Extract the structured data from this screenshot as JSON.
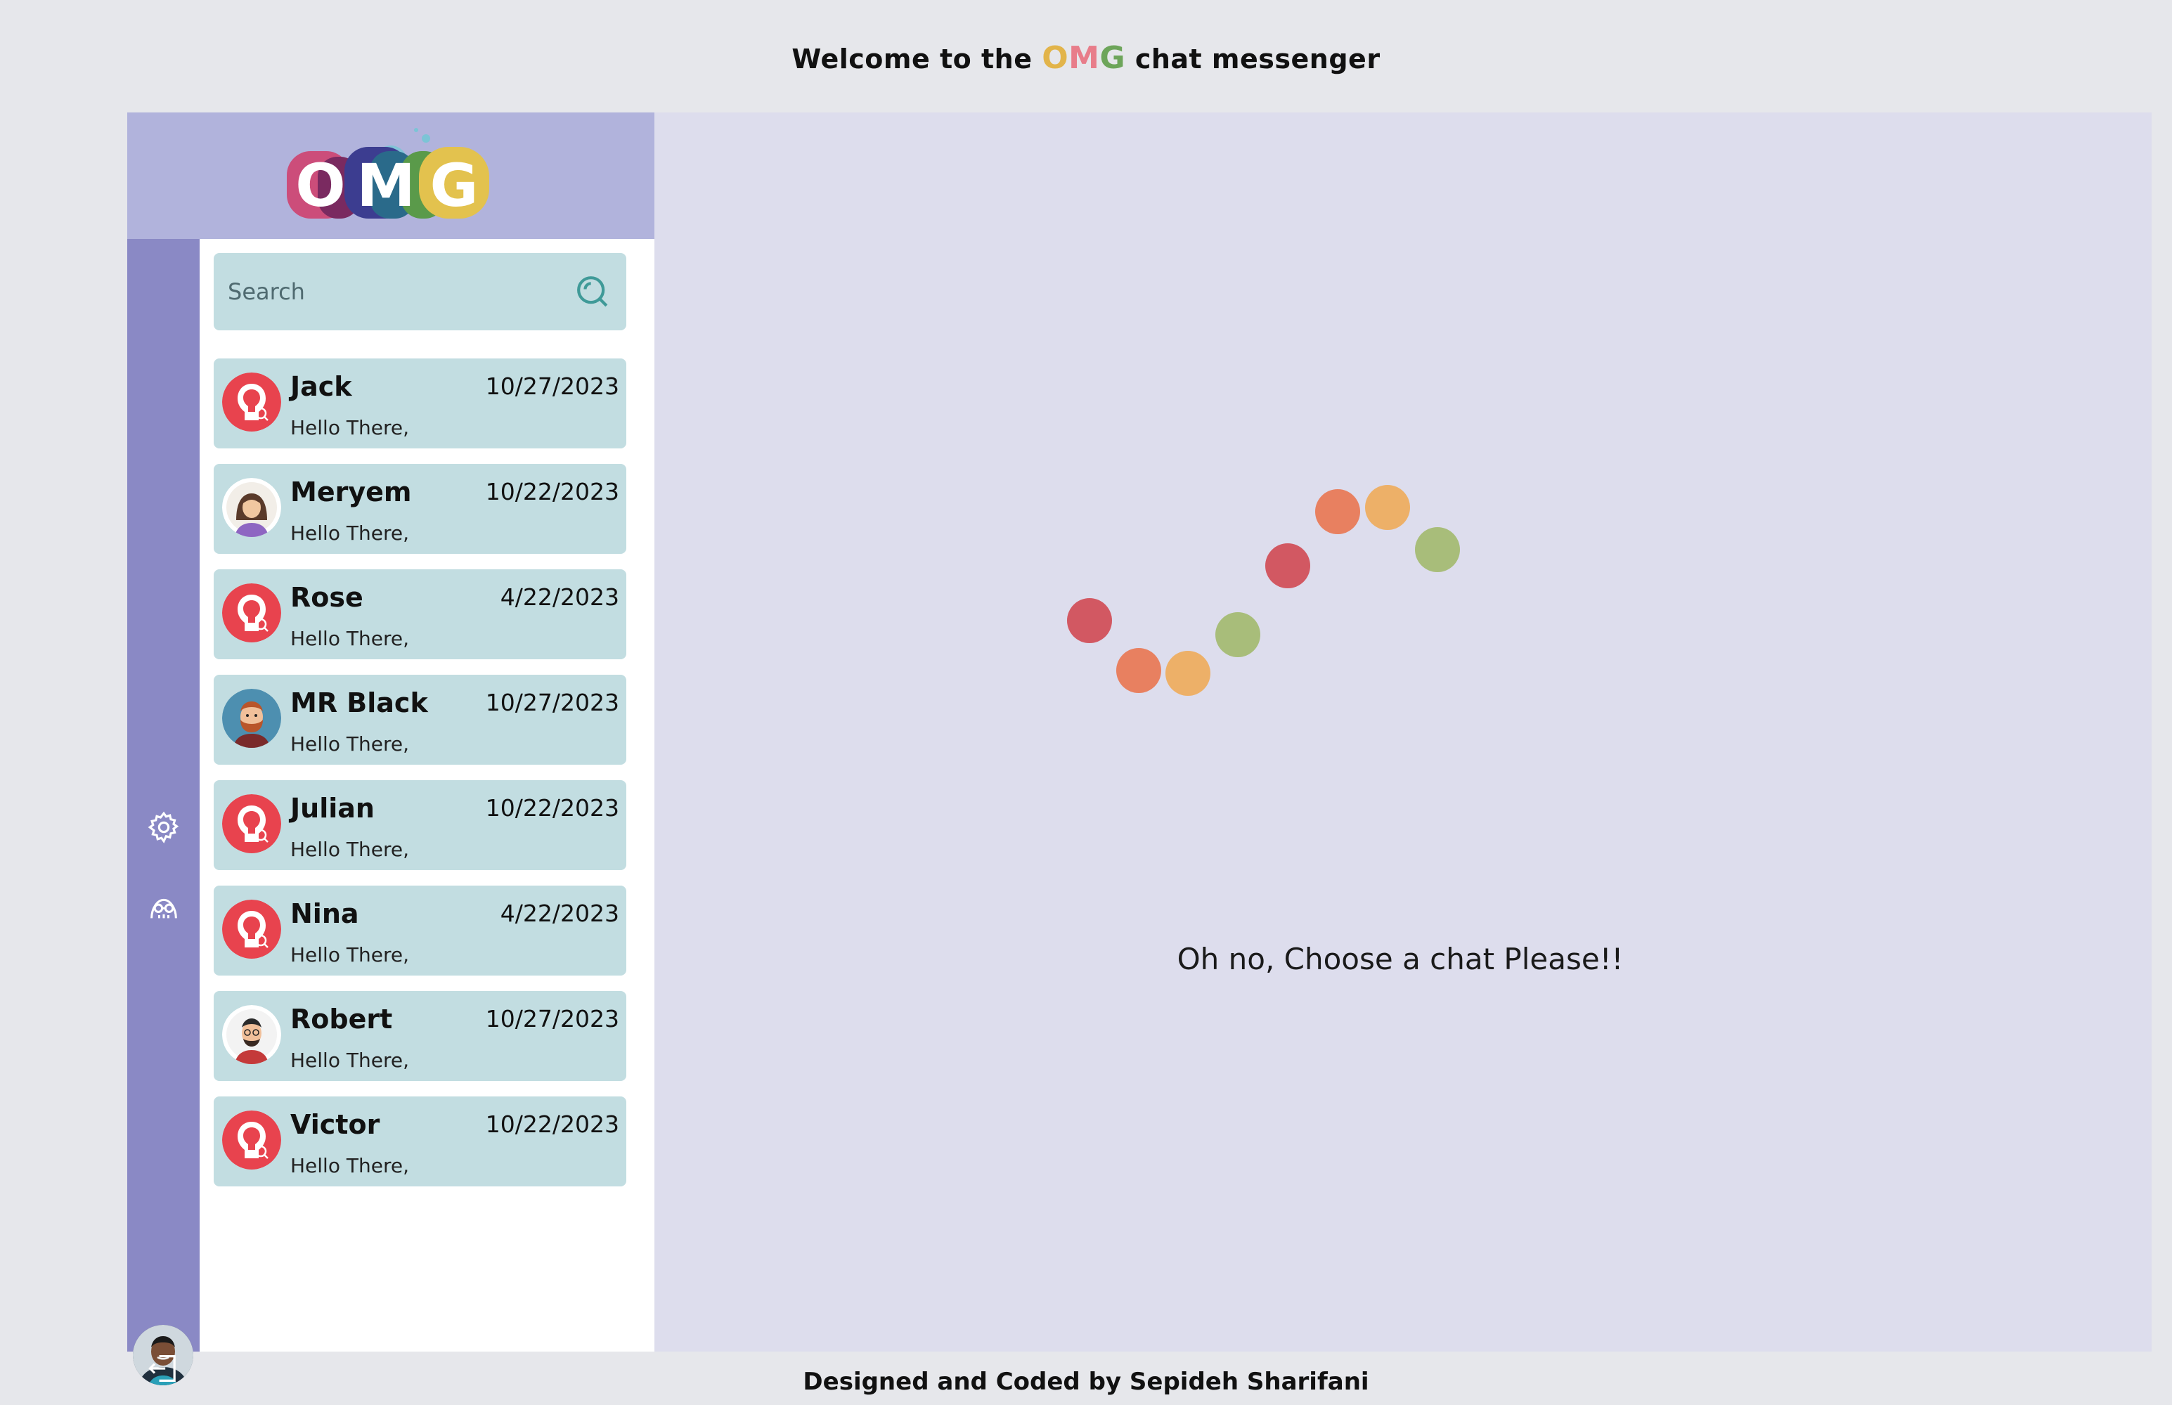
{
  "header": {
    "prefix": "Welcome to the",
    "brand_o": "O",
    "brand_m": "M",
    "brand_g": "G",
    "suffix": "chat messenger"
  },
  "logo": {
    "text": "OMG"
  },
  "search": {
    "placeholder": "Search",
    "value": ""
  },
  "sidebar": {
    "icons": [
      "gear-icon",
      "incognito-icon",
      "user-avatar",
      "logout-icon"
    ]
  },
  "chats": [
    {
      "name": "Jack",
      "date": "10/27/2023",
      "preview": "Hello There,",
      "avatar": "default-avatar"
    },
    {
      "name": "Meryem",
      "date": "10/22/2023",
      "preview": "Hello There,",
      "avatar": "woman-avatar"
    },
    {
      "name": "Rose",
      "date": "4/22/2023",
      "preview": "Hello There,",
      "avatar": "default-avatar"
    },
    {
      "name": "MR Black",
      "date": "10/27/2023",
      "preview": "Hello There,",
      "avatar": "bearded-man-avatar"
    },
    {
      "name": "Julian",
      "date": "10/22/2023",
      "preview": "Hello There,",
      "avatar": "default-avatar"
    },
    {
      "name": "Nina",
      "date": "4/22/2023",
      "preview": "Hello There,",
      "avatar": "default-avatar"
    },
    {
      "name": "Robert",
      "date": "10/27/2023",
      "preview": "Hello There,",
      "avatar": "glasses-man-avatar"
    },
    {
      "name": "Victor",
      "date": "10/22/2023",
      "preview": "Hello There,",
      "avatar": "default-avatar"
    }
  ],
  "main": {
    "empty_message": "Oh no, Choose a chat Please!!"
  },
  "footer": {
    "credit": "Designed and Coded by Sepideh Sharifani"
  },
  "colors": {
    "logo_band": "#b1b3dc",
    "icon_rail": "#8a89c5",
    "chat_item": "#c2dde1",
    "main_bg": "#dddded",
    "page_bg": "#e6e7eb",
    "dot_red": "#d25862",
    "dot_orange": "#e88060",
    "dot_peach": "#edb068",
    "dot_green": "#a8bd7a"
  }
}
